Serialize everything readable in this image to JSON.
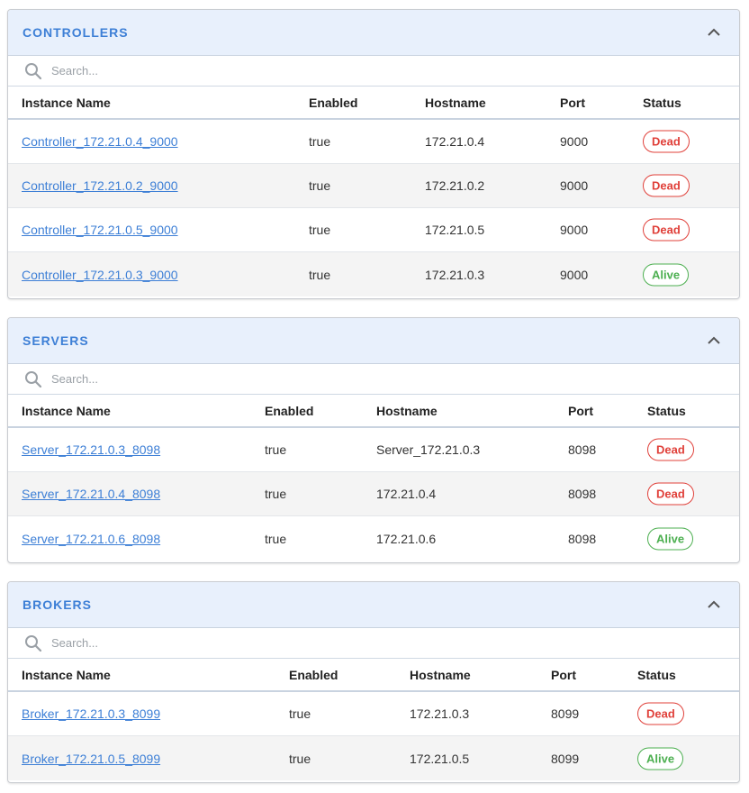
{
  "search_placeholder": "Search...",
  "columns": [
    "Instance Name",
    "Enabled",
    "Hostname",
    "Port",
    "Status"
  ],
  "status_colors": {
    "dead": "#e0403a",
    "alive": "#4caf50"
  },
  "accent_color": "#3d7fd6",
  "sections": [
    {
      "title": "CONTROLLERS",
      "rows": [
        {
          "name": "Controller_172.21.0.4_9000",
          "enabled": "true",
          "hostname": "172.21.0.4",
          "port": "9000",
          "status": "Dead"
        },
        {
          "name": "Controller_172.21.0.2_9000",
          "enabled": "true",
          "hostname": "172.21.0.2",
          "port": "9000",
          "status": "Dead"
        },
        {
          "name": "Controller_172.21.0.5_9000",
          "enabled": "true",
          "hostname": "172.21.0.5",
          "port": "9000",
          "status": "Dead"
        },
        {
          "name": "Controller_172.21.0.3_9000",
          "enabled": "true",
          "hostname": "172.21.0.3",
          "port": "9000",
          "status": "Alive"
        }
      ]
    },
    {
      "title": "SERVERS",
      "rows": [
        {
          "name": "Server_172.21.0.3_8098",
          "enabled": "true",
          "hostname": "Server_172.21.0.3",
          "port": "8098",
          "status": "Dead"
        },
        {
          "name": "Server_172.21.0.4_8098",
          "enabled": "true",
          "hostname": "172.21.0.4",
          "port": "8098",
          "status": "Dead"
        },
        {
          "name": "Server_172.21.0.6_8098",
          "enabled": "true",
          "hostname": "172.21.0.6",
          "port": "8098",
          "status": "Alive"
        }
      ]
    },
    {
      "title": "BROKERS",
      "rows": [
        {
          "name": "Broker_172.21.0.3_8099",
          "enabled": "true",
          "hostname": "172.21.0.3",
          "port": "8099",
          "status": "Dead"
        },
        {
          "name": "Broker_172.21.0.5_8099",
          "enabled": "true",
          "hostname": "172.21.0.5",
          "port": "8099",
          "status": "Alive"
        }
      ]
    }
  ]
}
